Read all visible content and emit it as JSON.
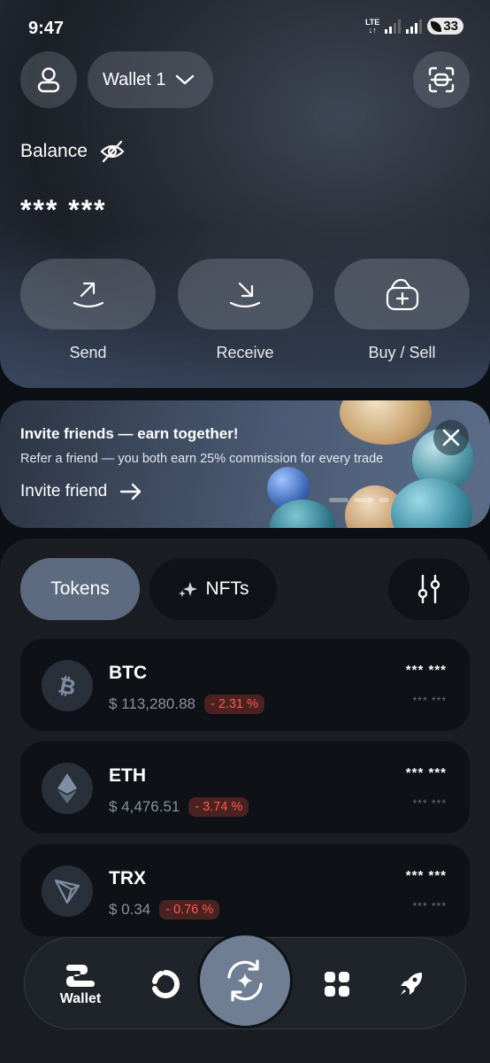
{
  "status_bar": {
    "time": "9:47",
    "network": "LTE",
    "battery": "33"
  },
  "header": {
    "wallet_name": "Wallet 1",
    "icons": [
      "profile-icon",
      "chevron-down-icon",
      "scan-icon"
    ]
  },
  "balance": {
    "label": "Balance",
    "value": "*** ***"
  },
  "actions": [
    {
      "label": "Send",
      "icon": "send-arrow-icon"
    },
    {
      "label": "Receive",
      "icon": "receive-arrow-icon"
    },
    {
      "label": "Buy / Sell",
      "icon": "buy-sell-icon"
    }
  ],
  "promo": {
    "title": "Invite friends — earn together!",
    "description": "Refer a friend — you both earn 25% commission for every trade",
    "link": "Invite friend"
  },
  "tabs": {
    "tokens": "Tokens",
    "nfts": "NFTs"
  },
  "tokens": [
    {
      "symbol": "BTC",
      "price": "$ 113,280.88",
      "change": "- 2.31 %",
      "amount": "*** ***",
      "fiat": "*** ***"
    },
    {
      "symbol": "ETH",
      "price": "$ 4,476.51",
      "change": "- 3.74 %",
      "amount": "*** ***",
      "fiat": "*** ***"
    },
    {
      "symbol": "TRX",
      "price": "$ 0.34",
      "change": "- 0.76 %",
      "amount": "*** ***",
      "fiat": "*** ***"
    }
  ],
  "nav": {
    "wallet_label": "Wallet"
  },
  "colors": {
    "accent_tab": "#5d6b80",
    "negative_change": "#ff5a4a",
    "card_bg": "#0e1115"
  }
}
